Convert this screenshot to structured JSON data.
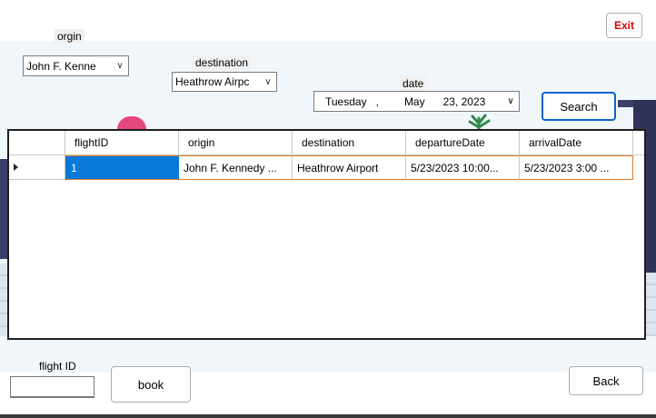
{
  "window": {
    "exit_label": "Exit"
  },
  "origin": {
    "label": "orgin",
    "selected": "John F. Kenne"
  },
  "destination": {
    "label": "destination",
    "selected": "Heathrow Airpc"
  },
  "date": {
    "label": "date",
    "weekday": "Tuesday",
    "separator": ",",
    "month": "May",
    "day_year": "23, 2023"
  },
  "search": {
    "label": "Search"
  },
  "grid": {
    "columns": [
      "flightID",
      "origin",
      "destination",
      "departureDate",
      "arrivalDate"
    ],
    "rows": [
      {
        "flightID": "1",
        "origin": "John F. Kennedy ...",
        "destination": "Heathrow Airport",
        "departureDate": "5/23/2023 10:00...",
        "arrivalDate": "5/23/2023 3:00 ..."
      }
    ]
  },
  "booking": {
    "label": "flight ID",
    "value": "",
    "book_label": "book"
  },
  "back": {
    "label": "Back"
  },
  "colors": {
    "exit": "#e00000",
    "selection": "#0a78d7",
    "row_border": "#e07b2b",
    "focus": "#0a64c8"
  }
}
